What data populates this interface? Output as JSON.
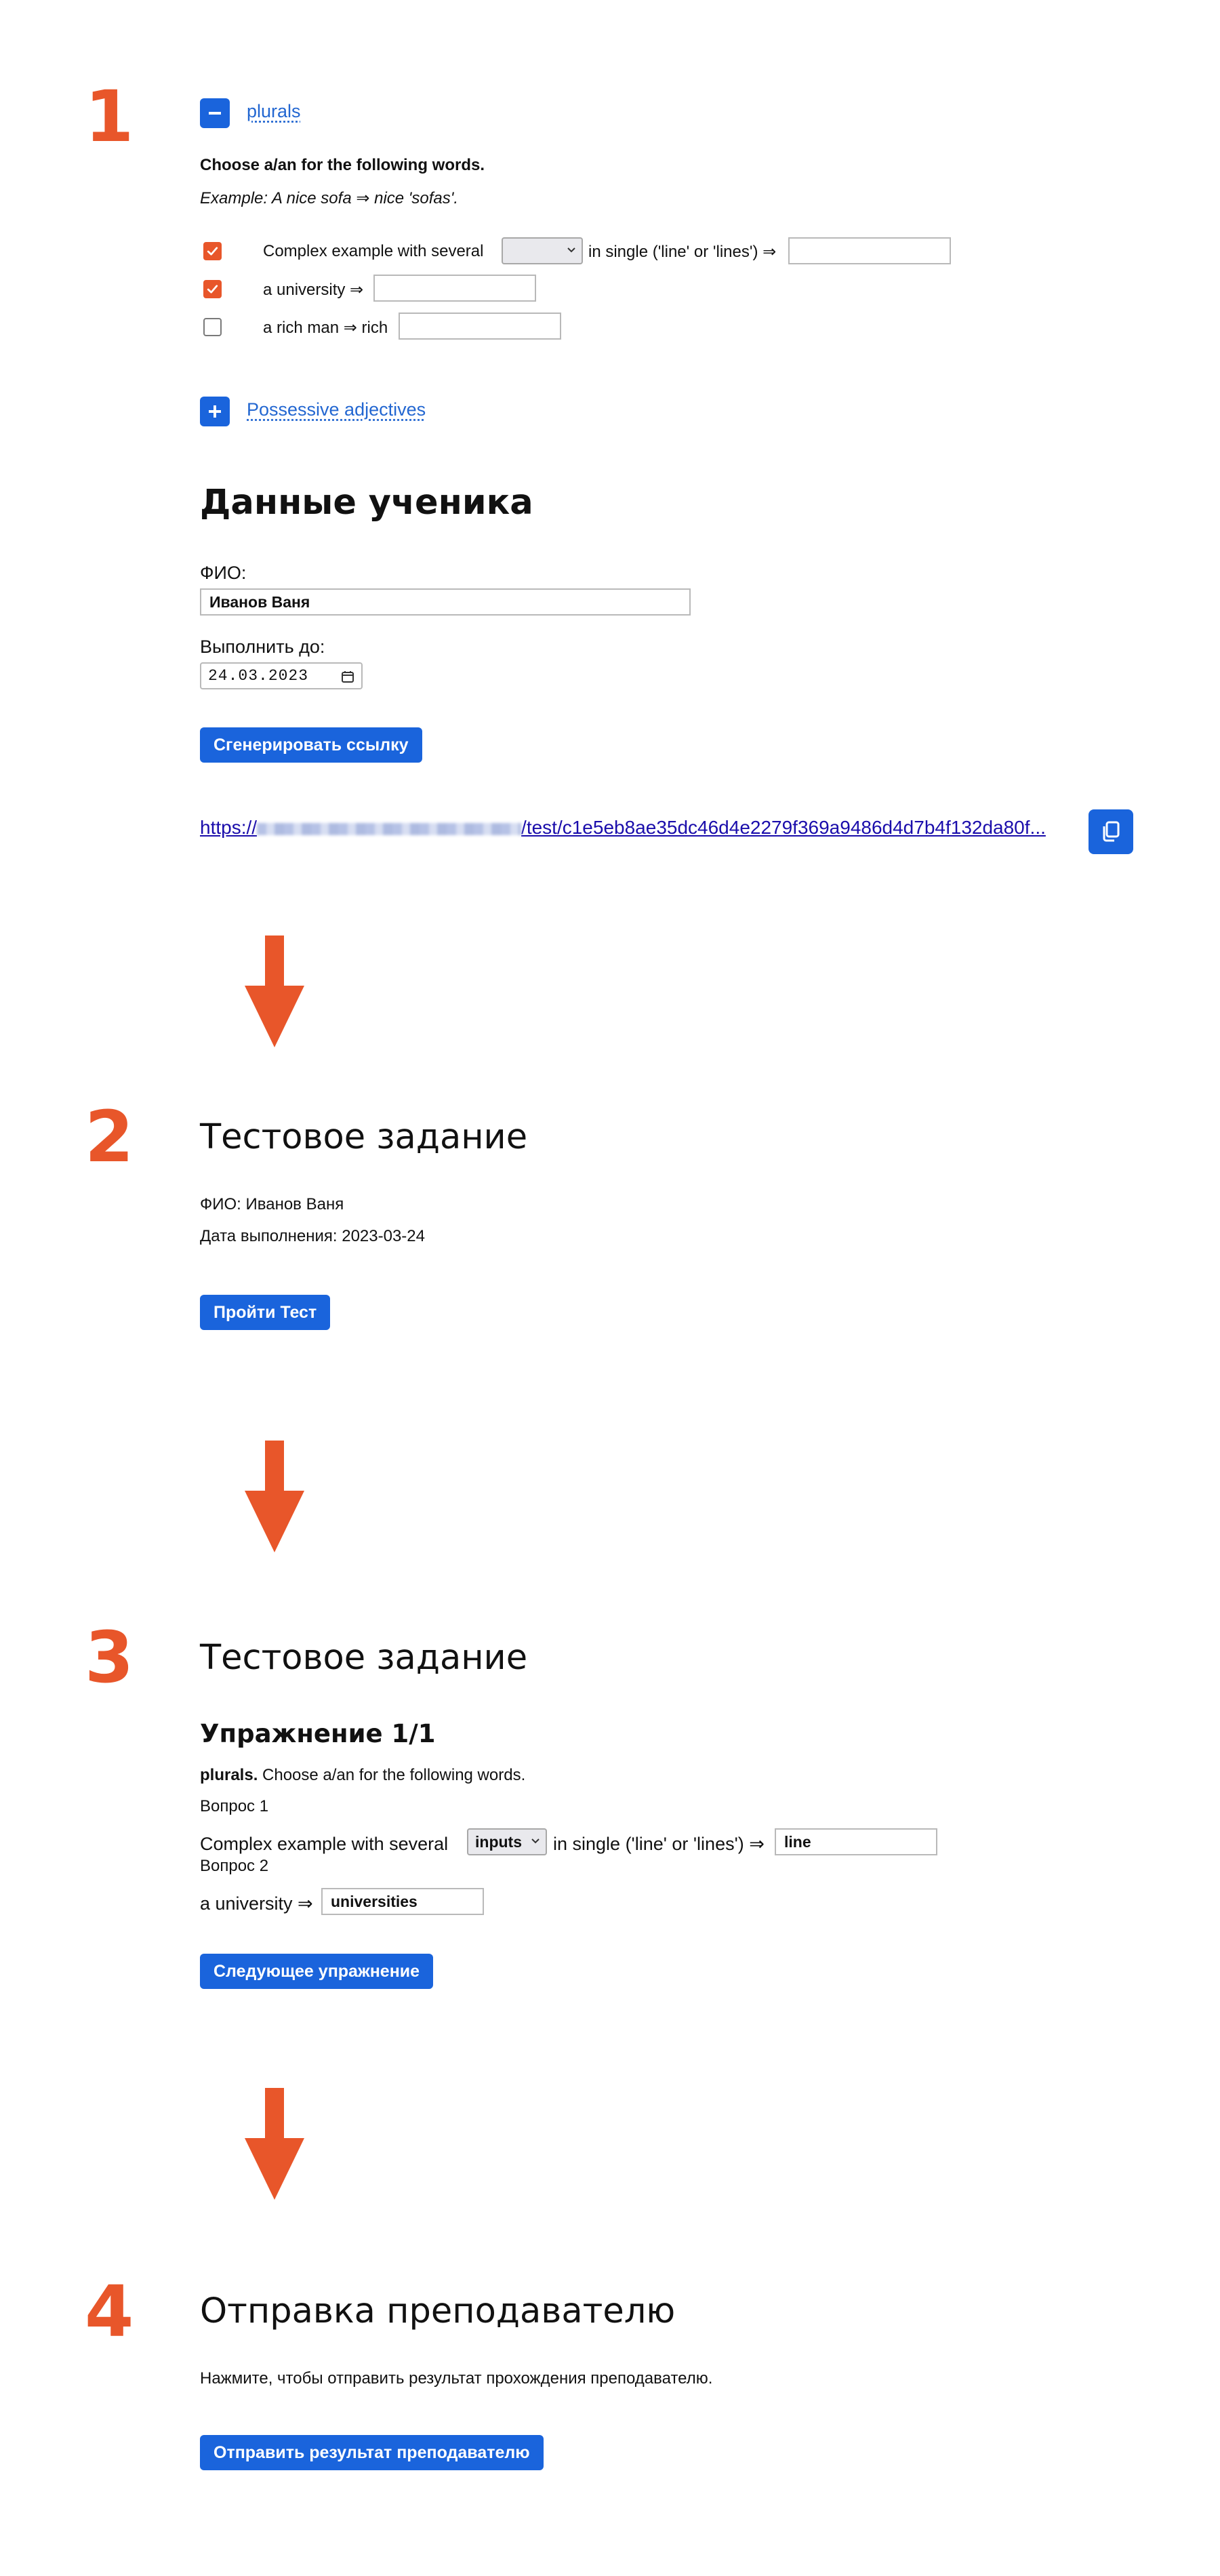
{
  "theme": {
    "accent": "#e8562a",
    "brand": "#1a64dc",
    "link": "#1a0dab"
  },
  "steps": {
    "s1": "1",
    "s2": "2",
    "s3": "3",
    "s4": "4"
  },
  "topic_plurals": {
    "title": "plurals",
    "instruction": "Choose a/an for the following words.",
    "example": "Example: A nice sofa ⇒ nice 'sofas'.",
    "rows": [
      {
        "checked": true,
        "prefix": "Complex example with several",
        "select_value": "",
        "middle": "in single ('line' or 'lines') ⇒",
        "input_value": ""
      },
      {
        "checked": true,
        "prefix": "a university ⇒",
        "input_value": ""
      },
      {
        "checked": false,
        "prefix": "a rich man ⇒ rich",
        "input_value": ""
      }
    ]
  },
  "topic_possessive": {
    "title": "Possessive adjectives"
  },
  "student": {
    "heading": "Данные ученика",
    "name_label": "ФИО:",
    "name_value": "Иванов Ваня",
    "due_label": "Выполнить до:",
    "due_value": "24.03.2023",
    "generate_button": "Сгенерировать ссылку",
    "link_prefix": "https://",
    "link_suffix": "/test/c1e5eb8ae35dc46d4e2279f369a9486d4d7b4f132da80f..."
  },
  "test_intro": {
    "heading": "Тестовое задание",
    "name_line": "ФИО: Иванов Ваня",
    "date_line": "Дата выполнения: 2023-03-24",
    "start_button": "Пройти Тест"
  },
  "exercise": {
    "heading": "Тестовое задание",
    "subheading": "Упражнение 1/1",
    "topic_bold": "plurals.",
    "topic_rest": " Choose a/an for the following words.",
    "q1_label": "Вопрос 1",
    "q1_prefix": "Complex example with several",
    "q1_select": "inputs",
    "q1_middle": "in single ('line' or 'lines') ⇒",
    "q1_input": "line",
    "q2_label": "Вопрос 2",
    "q2_prefix": "a university ⇒",
    "q2_input": "universities",
    "next_button": "Следующее упражнение"
  },
  "send": {
    "heading": "Отправка преподавателю",
    "text": "Нажмите, чтобы отправить результат прохождения преподавателю.",
    "button": "Отправить результат преподавателю"
  },
  "icons": {
    "collapse": "minus-icon",
    "expand": "plus-icon",
    "check": "checkmark-icon",
    "copy": "copy-icon",
    "calendar": "calendar-icon",
    "arrow": "arrow-down-icon"
  }
}
